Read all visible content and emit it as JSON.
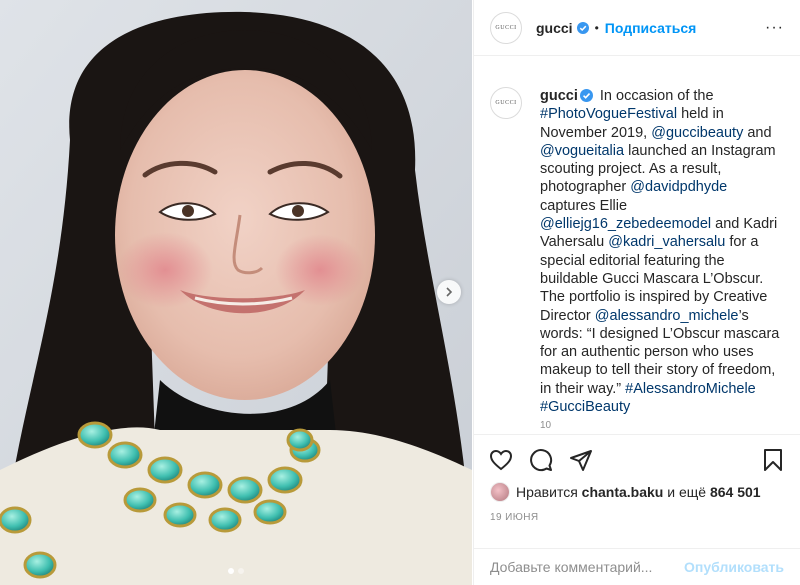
{
  "post": {
    "image_alt": "Portrait photo",
    "carousel": {
      "dots": 2,
      "active_index": 0
    }
  },
  "header": {
    "avatar_text": "GUCCI",
    "username": "gucci",
    "separator": "•",
    "follow_label": "Подписаться",
    "more_label": "···"
  },
  "caption": {
    "avatar_text": "GUCCI",
    "username": "gucci",
    "parts": [
      {
        "t": "text",
        "v": " In occasion of the "
      },
      {
        "t": "link",
        "v": "#PhotoVogueFestival"
      },
      {
        "t": "text",
        "v": " held in November 2019, "
      },
      {
        "t": "link",
        "v": "@guccibeauty"
      },
      {
        "t": "text",
        "v": " and "
      },
      {
        "t": "link",
        "v": "@vogueitalia"
      },
      {
        "t": "text",
        "v": " launched an Instagram scouting project. As a result, photographer "
      },
      {
        "t": "link",
        "v": "@davidpdhyde"
      },
      {
        "t": "text",
        "v": " captures Ellie "
      },
      {
        "t": "link",
        "v": "@elliejg16_zebedeemodel"
      },
      {
        "t": "text",
        "v": " and Kadri Vahersalu "
      },
      {
        "t": "link",
        "v": "@kadri_vahersalu"
      },
      {
        "t": "text",
        "v": " for a special editorial featuring the buildable Gucci Mascara L’Obscur. The portfolio is inspired by Creative Director "
      },
      {
        "t": "link",
        "v": "@alessandro_michele"
      },
      {
        "t": "text",
        "v": "’s words: “I designed L’Obscur mascara for an authentic person who uses makeup to tell their story of freedom, in their way.” "
      },
      {
        "t": "link",
        "v": "#AlessandroMichele"
      },
      {
        "t": "text",
        "v": " "
      },
      {
        "t": "link",
        "v": "#GucciBeauty"
      }
    ],
    "time_cut": "10"
  },
  "actions": {
    "like_icon": "heart-icon",
    "comment_icon": "comment-icon",
    "share_icon": "share-icon",
    "save_icon": "bookmark-icon"
  },
  "likes": {
    "prefix": "Нравится ",
    "user": "chanta.baku",
    "middle": " и ещё ",
    "count": "864 501"
  },
  "date": "19 ИЮНЯ",
  "comment_box": {
    "placeholder": "Добавьте комментарий...",
    "publish_label": "Опубликовать"
  },
  "colors": {
    "accent": "#0095f6",
    "link": "#00376b",
    "publish_disabled": "#b2dffc",
    "muted": "#8e8e8e",
    "verified": "#3897f0"
  }
}
